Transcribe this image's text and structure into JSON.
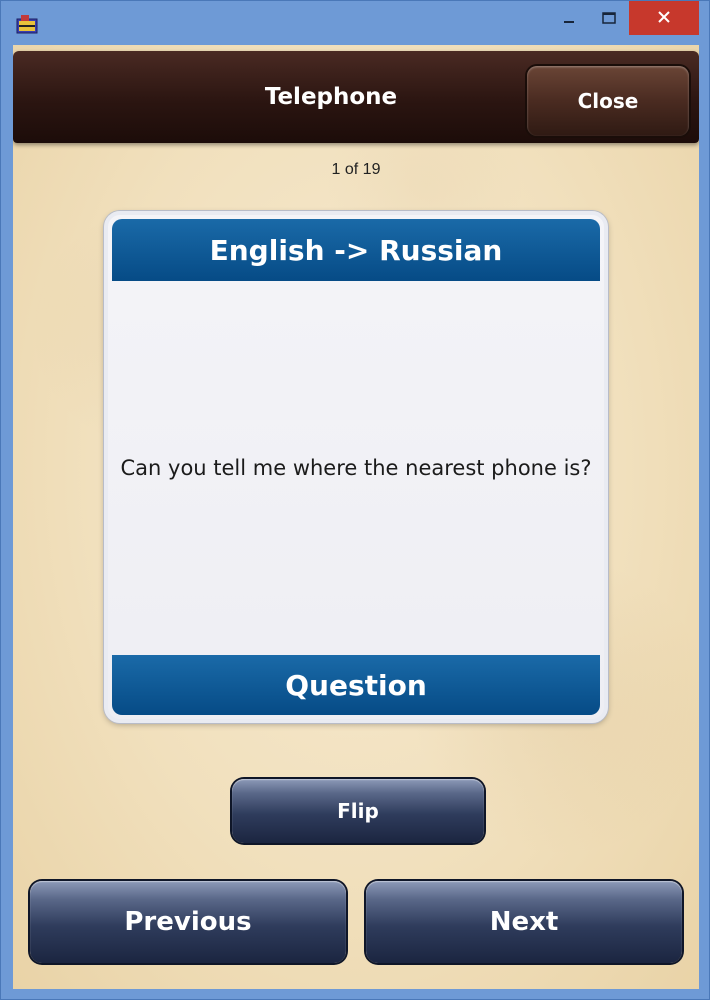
{
  "window": {
    "icon": "app-book-icon",
    "controls": {
      "minimize_icon": "minimize-icon",
      "maximize_icon": "maximize-icon",
      "close_icon": "close-icon"
    }
  },
  "header": {
    "title": "Telephone",
    "close_label": "Close"
  },
  "progress": {
    "text": "1 of 19",
    "current": 1,
    "total": 19
  },
  "card": {
    "direction": "English -> Russian",
    "text": "Can you tell me where the nearest phone is?",
    "side_label": "Question"
  },
  "actions": {
    "flip_label": "Flip",
    "previous_label": "Previous",
    "next_label": "Next"
  },
  "colors": {
    "header_bar": "#2b1511",
    "card_band": "#064b86",
    "button_navy": "#2f3c5c",
    "parchment": "#f1e0bd",
    "window_close": "#c7382c"
  }
}
